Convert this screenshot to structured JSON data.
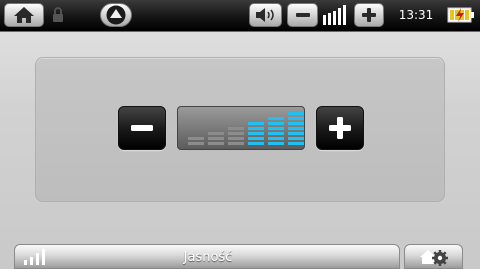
{
  "status_bar": {
    "clock": "13:31",
    "icons": {
      "home": "home-icon",
      "lock": "lock-icon",
      "navigate_up": "up-arrow-icon",
      "speaker": "speaker-icon",
      "volume_down": "minus-icon",
      "volume_level": "volume-bars-icon",
      "volume_up": "plus-icon",
      "battery": "battery-charging-icon"
    }
  },
  "brightness_panel": {
    "decrease_icon": "minus-icon",
    "increase_icon": "plus-icon",
    "level": 3,
    "max_level": 6,
    "active_color": "#22c0f0",
    "inactive_color": "#8c8c8c"
  },
  "bottom_bar": {
    "title": "Jasność",
    "signal_icon": "signal-bars-icon",
    "settings_icon": "gear-house-icon"
  }
}
